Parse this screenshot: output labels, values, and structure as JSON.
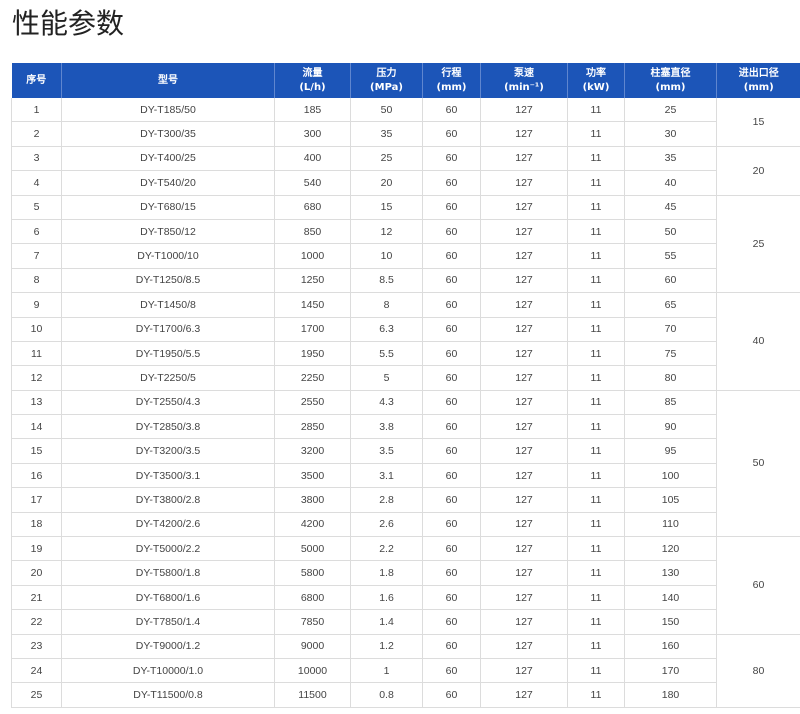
{
  "page": {
    "title": "性能参数"
  },
  "table": {
    "headers": [
      {
        "label": "序号",
        "unit": ""
      },
      {
        "label": "型号",
        "unit": ""
      },
      {
        "label": "流量",
        "unit": "(L/h)"
      },
      {
        "label": "压力",
        "unit": "(MPa)"
      },
      {
        "label": "行程",
        "unit": "(mm)"
      },
      {
        "label": "泵速",
        "unit": "(min⁻¹)"
      },
      {
        "label": "功率",
        "unit": "(kW)"
      },
      {
        "label": "柱塞直径",
        "unit": "(mm)"
      },
      {
        "label": "进出口径",
        "unit": "(mm)"
      }
    ],
    "rows": [
      [
        "1",
        "DY-T185/50",
        "185",
        "50",
        "60",
        "127",
        "11",
        "25"
      ],
      [
        "2",
        "DY-T300/35",
        "300",
        "35",
        "60",
        "127",
        "11",
        "30"
      ],
      [
        "3",
        "DY-T400/25",
        "400",
        "25",
        "60",
        "127",
        "11",
        "35"
      ],
      [
        "4",
        "DY-T540/20",
        "540",
        "20",
        "60",
        "127",
        "11",
        "40"
      ],
      [
        "5",
        "DY-T680/15",
        "680",
        "15",
        "60",
        "127",
        "11",
        "45"
      ],
      [
        "6",
        "DY-T850/12",
        "850",
        "12",
        "60",
        "127",
        "11",
        "50"
      ],
      [
        "7",
        "DY-T1000/10",
        "1000",
        "10",
        "60",
        "127",
        "11",
        "55"
      ],
      [
        "8",
        "DY-T1250/8.5",
        "1250",
        "8.5",
        "60",
        "127",
        "11",
        "60"
      ],
      [
        "9",
        "DY-T1450/8",
        "1450",
        "8",
        "60",
        "127",
        "11",
        "65"
      ],
      [
        "10",
        "DY-T1700/6.3",
        "1700",
        "6.3",
        "60",
        "127",
        "11",
        "70"
      ],
      [
        "11",
        "DY-T1950/5.5",
        "1950",
        "5.5",
        "60",
        "127",
        "11",
        "75"
      ],
      [
        "12",
        "DY-T2250/5",
        "2250",
        "5",
        "60",
        "127",
        "11",
        "80"
      ],
      [
        "13",
        "DY-T2550/4.3",
        "2550",
        "4.3",
        "60",
        "127",
        "11",
        "85"
      ],
      [
        "14",
        "DY-T2850/3.8",
        "2850",
        "3.8",
        "60",
        "127",
        "11",
        "90"
      ],
      [
        "15",
        "DY-T3200/3.5",
        "3200",
        "3.5",
        "60",
        "127",
        "11",
        "95"
      ],
      [
        "16",
        "DY-T3500/3.1",
        "3500",
        "3.1",
        "60",
        "127",
        "11",
        "100"
      ],
      [
        "17",
        "DY-T3800/2.8",
        "3800",
        "2.8",
        "60",
        "127",
        "11",
        "105"
      ],
      [
        "18",
        "DY-T4200/2.6",
        "4200",
        "2.6",
        "60",
        "127",
        "11",
        "110"
      ],
      [
        "19",
        "DY-T5000/2.2",
        "5000",
        "2.2",
        "60",
        "127",
        "11",
        "120"
      ],
      [
        "20",
        "DY-T5800/1.8",
        "5800",
        "1.8",
        "60",
        "127",
        "11",
        "130"
      ],
      [
        "21",
        "DY-T6800/1.6",
        "6800",
        "1.6",
        "60",
        "127",
        "11",
        "140"
      ],
      [
        "22",
        "DY-T7850/1.4",
        "7850",
        "1.4",
        "60",
        "127",
        "11",
        "150"
      ],
      [
        "23",
        "DY-T9000/1.2",
        "9000",
        "1.2",
        "60",
        "127",
        "11",
        "160"
      ],
      [
        "24",
        "DY-T10000/1.0",
        "10000",
        "1",
        "60",
        "127",
        "11",
        "170"
      ],
      [
        "25",
        "DY-T11500/0.8",
        "11500",
        "0.8",
        "60",
        "127",
        "11",
        "180"
      ]
    ],
    "port_groups": [
      {
        "value": "15",
        "rows": 2
      },
      {
        "value": "20",
        "rows": 2
      },
      {
        "value": "25",
        "rows": 4
      },
      {
        "value": "40",
        "rows": 4
      },
      {
        "value": "50",
        "rows": 6
      },
      {
        "value": "60",
        "rows": 4
      },
      {
        "value": "80",
        "rows": 3
      }
    ]
  },
  "colors": {
    "header_bg": "#1c55b8",
    "header_text": "#ffffff",
    "grid": "#dcdcdc",
    "text": "#444444"
  }
}
